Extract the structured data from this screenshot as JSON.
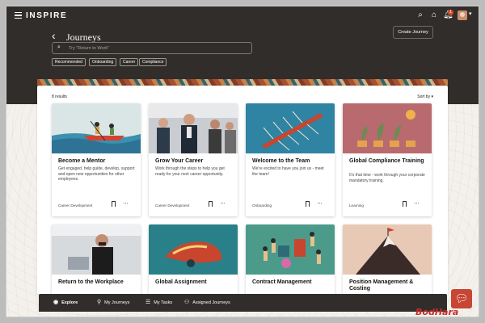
{
  "app": {
    "brand": "INSPIRE",
    "notification_count": "1"
  },
  "page": {
    "title": "Journeys",
    "create_button": "Create Journey"
  },
  "search": {
    "placeholder": "Try \"Return to Work\""
  },
  "filters": [
    "Recommended",
    "Onboarding",
    "Career",
    "Compliance"
  ],
  "results": {
    "count_label": "8 results",
    "sort_label": "Sort by"
  },
  "cards": [
    {
      "title": "Become a Mentor",
      "description": "Get engaged, help guide, develop, support and open new opportunities for other employees.",
      "category": "Career Development"
    },
    {
      "title": "Grow Your Career",
      "description": "Work through the steps to help you get ready for your next career opportunity.",
      "category": "Career Development"
    },
    {
      "title": "Welcome to the Team",
      "description": "We're excited to have you join us - meet the team!",
      "category": "Onboarding"
    },
    {
      "title": "Global Compliance Training",
      "description": "It's that time - work through your corporate mandatory training.",
      "category": "Learning"
    },
    {
      "title": "Return to the Workplace",
      "description": "",
      "category": ""
    },
    {
      "title": "Global Assignment",
      "description": "",
      "category": ""
    },
    {
      "title": "Contract Management",
      "description": "",
      "category": ""
    },
    {
      "title": "Position Management & Costing",
      "description": "",
      "category": ""
    }
  ],
  "bottom_nav": [
    {
      "label": "Explore",
      "icon": "explore-icon"
    },
    {
      "label": "My Journeys",
      "icon": "my-journeys-icon"
    },
    {
      "label": "My Tasks",
      "icon": "my-tasks-icon"
    },
    {
      "label": "Assigned Journeys",
      "icon": "assigned-journeys-icon"
    }
  ],
  "watermark": "BodHara",
  "colors": {
    "header": "#312d2a",
    "accent": "#c74634"
  }
}
